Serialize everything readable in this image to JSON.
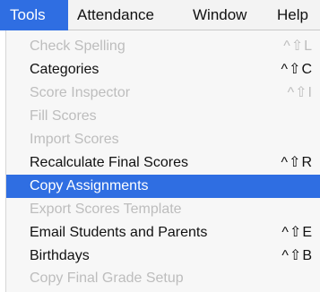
{
  "menubar": {
    "items": [
      {
        "label": "Tools",
        "active": true
      },
      {
        "label": "Attendance"
      },
      {
        "label": "Window"
      },
      {
        "label": "Help"
      }
    ]
  },
  "dropdown": {
    "items": [
      {
        "label": "Check Spelling",
        "shortcut": "^⇧L",
        "enabled": false
      },
      {
        "label": "Categories",
        "shortcut": "^⇧C",
        "enabled": true
      },
      {
        "label": "Score Inspector",
        "shortcut": "^⇧I",
        "enabled": false
      },
      {
        "label": "Fill Scores",
        "shortcut": "",
        "enabled": false
      },
      {
        "label": "Import Scores",
        "shortcut": "",
        "enabled": false
      },
      {
        "label": "Recalculate Final Scores",
        "shortcut": "^⇧R",
        "enabled": true
      },
      {
        "label": "Copy Assignments",
        "shortcut": "",
        "enabled": true,
        "highlighted": true
      },
      {
        "label": "Export Scores Template",
        "shortcut": "",
        "enabled": false
      },
      {
        "label": "Email Students and Parents",
        "shortcut": "^⇧E",
        "enabled": true
      },
      {
        "label": "Birthdays",
        "shortcut": "^⇧B",
        "enabled": true
      },
      {
        "label": "Copy Final Grade Setup",
        "shortcut": "",
        "enabled": false
      }
    ]
  },
  "colors": {
    "highlight": "#2f6ee2",
    "menu_background": "#f7f7f7",
    "disabled_text": "#bdbdbd"
  }
}
